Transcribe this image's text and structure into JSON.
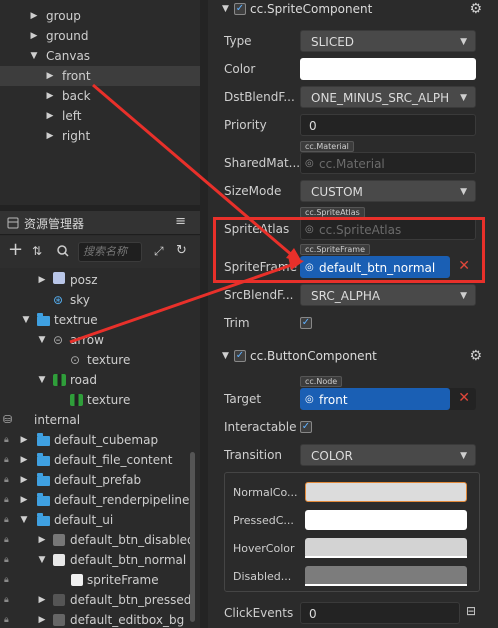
{
  "hierarchy": {
    "items": [
      {
        "label": "group"
      },
      {
        "label": "ground"
      },
      {
        "label": "Canvas"
      },
      {
        "label": "front"
      },
      {
        "label": "back"
      },
      {
        "label": "left"
      },
      {
        "label": "right"
      }
    ]
  },
  "assets": {
    "title": "资源管理器",
    "search_placeholder": "搜索名称",
    "items": [
      {
        "label": "posz"
      },
      {
        "label": "sky"
      },
      {
        "label": "textrue"
      },
      {
        "label": "arrow"
      },
      {
        "label": "texture"
      },
      {
        "label": "road"
      },
      {
        "label": "texture"
      },
      {
        "label": "internal"
      },
      {
        "label": "default_cubemap"
      },
      {
        "label": "default_file_content"
      },
      {
        "label": "default_prefab"
      },
      {
        "label": "default_renderpipeline"
      },
      {
        "label": "default_ui"
      },
      {
        "label": "default_btn_disabled"
      },
      {
        "label": "default_btn_normal"
      },
      {
        "label": "spriteFrame"
      },
      {
        "label": "default_btn_pressed"
      },
      {
        "label": "default_editbox_bg"
      }
    ]
  },
  "sprite_component": {
    "title": "cc.SpriteComponent",
    "type_label": "Type",
    "type_value": "SLICED",
    "color_label": "Color",
    "color_value": "#ffffff",
    "dst_label": "DstBlendF...",
    "dst_value": "ONE_MINUS_SRC_ALPH",
    "priority_label": "Priority",
    "priority_value": "0",
    "material_tag": "cc.Material",
    "material_label": "SharedMat...",
    "material_placeholder": "cc.Material",
    "sizemode_label": "SizeMode",
    "sizemode_value": "CUSTOM",
    "atlas_tag": "cc.SpriteAtlas",
    "atlas_label": "SpriteAtlas",
    "atlas_placeholder": "cc.SpriteAtlas",
    "frame_tag": "cc.SpriteFrame",
    "frame_label": "SpriteFrame",
    "frame_value": "default_btn_normal",
    "src_label": "SrcBlendF...",
    "src_value": "SRC_ALPHA",
    "trim_label": "Trim"
  },
  "button_component": {
    "title": "cc.ButtonComponent",
    "target_tag": "cc.Node",
    "target_label": "Target",
    "target_value": "front",
    "interactable_label": "Interactable",
    "transition_label": "Transition",
    "transition_value": "COLOR",
    "normal_label": "NormalCo...",
    "normal_color": "#dcdcdc",
    "pressed_label": "PressedC...",
    "pressed_color": "#ffffff",
    "hover_label": "HoverColor",
    "hover_color": "#d3d3d3",
    "disabled_label": "Disabled...",
    "disabled_color": "#7c7c7c",
    "clickevents_label": "ClickEvents",
    "clickevents_value": "0"
  },
  "colors": {
    "accent": "#1a5fb4",
    "highlight": "#e8302a",
    "folder": "#3fa0e0"
  }
}
